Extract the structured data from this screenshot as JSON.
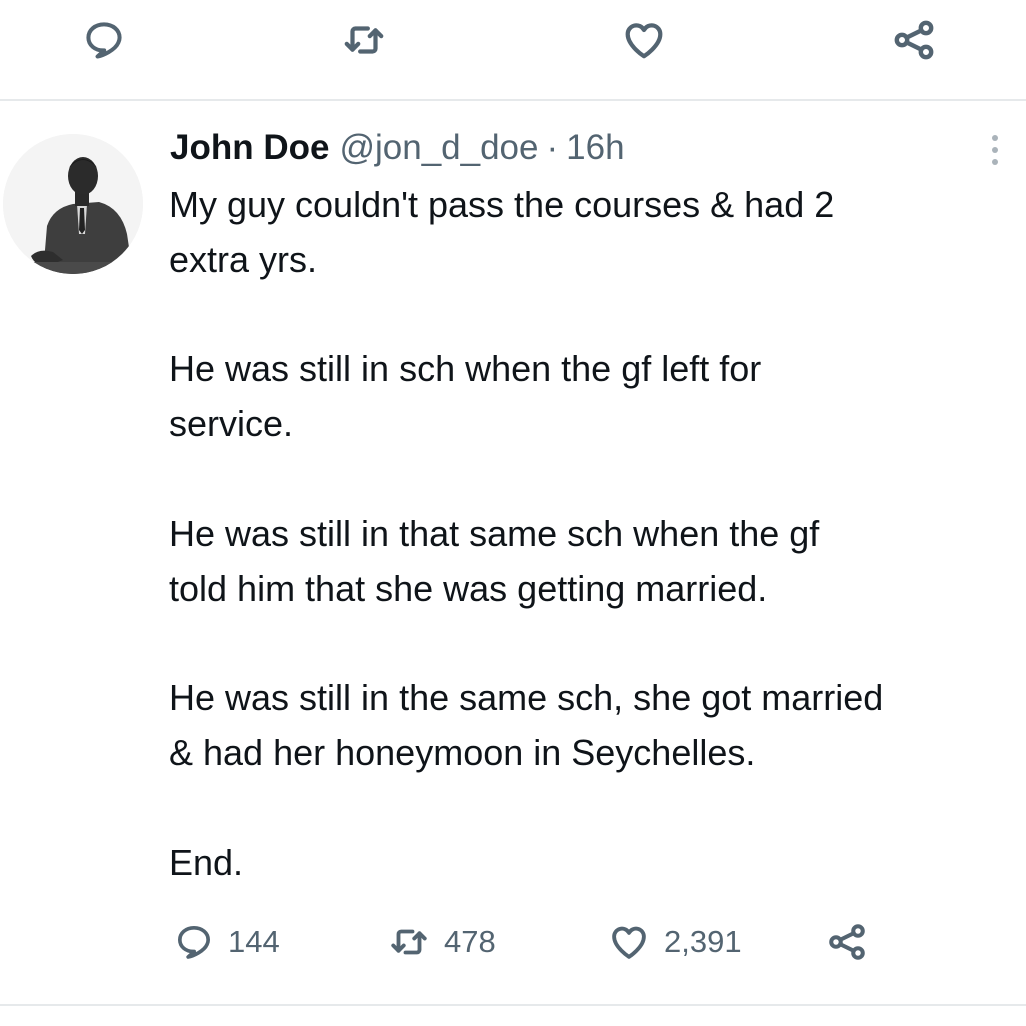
{
  "top_actions": {
    "reply_icon": "speech-bubble",
    "retweet_icon": "retweet-arrows",
    "like_icon": "heart",
    "share_icon": "share-nodes"
  },
  "tweet": {
    "author_name": "John Doe",
    "handle": "@jon_d_doe",
    "separator": "·",
    "time": "16h",
    "text": "My guy couldn't pass the courses & had 2\nextra yrs.\n\nHe was still in sch when the gf left for\nservice.\n\nHe was still in that same sch when the gf\ntold him that she was getting married.\n\nHe was still in the same sch, she got married\n& had her honeymoon in Seychelles.\n\nEnd.",
    "stats": {
      "replies": "144",
      "retweets": "478",
      "likes": "2,391"
    }
  },
  "colors": {
    "text": "#0f1419",
    "secondary": "#536471",
    "divider": "#e6e9eb"
  }
}
